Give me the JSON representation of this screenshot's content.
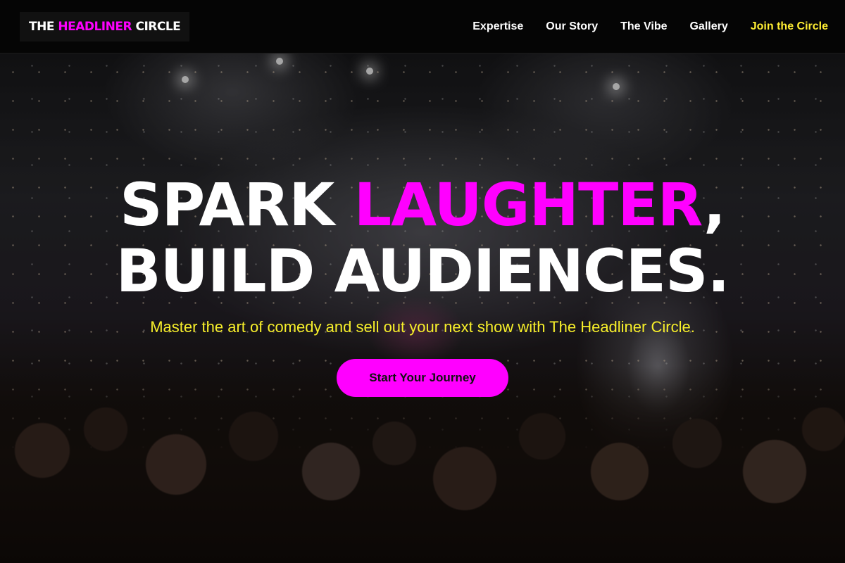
{
  "brand": {
    "logo_part1": "THE",
    "logo_part2": "HEADLINER",
    "logo_part3": "CIRCLE"
  },
  "nav": {
    "items": [
      {
        "label": "Expertise"
      },
      {
        "label": "Our Story"
      },
      {
        "label": "The Vibe"
      },
      {
        "label": "Gallery"
      }
    ],
    "cta_label": "Join the Circle"
  },
  "hero": {
    "headline_word1": "SPARK",
    "headline_accent": "LAUGHTER",
    "headline_comma": ",",
    "headline_line2": "BUILD AUDIENCES.",
    "subtext": "Master the art of comedy and sell out your next show with The Headliner Circle.",
    "button_label": "Start Your Journey",
    "background_image": "concert-crowd-photo"
  },
  "colors": {
    "accent": "#ff00ff",
    "highlight": "#f7ef2a",
    "nav_background": "#050505",
    "text": "#ffffff"
  }
}
